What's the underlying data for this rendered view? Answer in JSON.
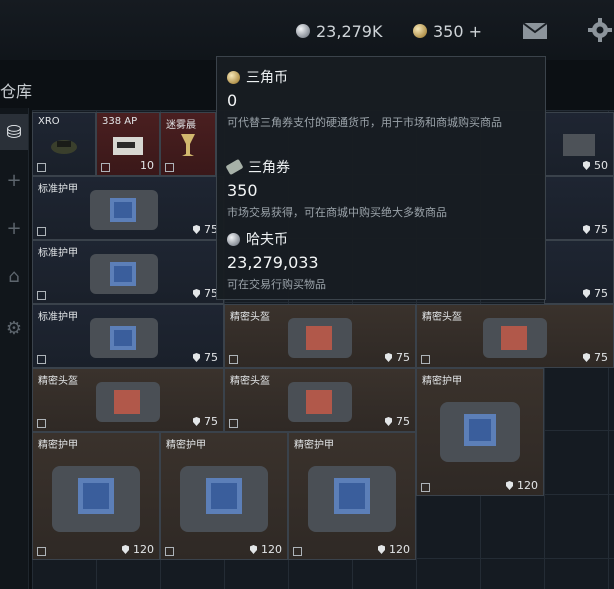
{
  "topbar": {
    "haf_coin": "23,279K",
    "triangle_coin": "350 +"
  },
  "sidebar": {
    "title": "仓库"
  },
  "items": [
    {
      "name": "XRO",
      "durability": ""
    },
    {
      "name": "338 AP",
      "durability": "10"
    },
    {
      "name": "迷雾晨",
      "durability": ""
    },
    {
      "name": "",
      "durability": "50"
    },
    {
      "name": "标准护甲",
      "durability": "75"
    },
    {
      "name": "",
      "durability": "75"
    },
    {
      "name": "标准护甲",
      "durability": "75"
    },
    {
      "name": "",
      "durability": "75"
    },
    {
      "name": "标准护甲",
      "durability": "75"
    },
    {
      "name": "精密头盔",
      "durability": "75"
    },
    {
      "name": "精密头盔",
      "durability": "75"
    },
    {
      "name": "精密头盔",
      "durability": "75"
    },
    {
      "name": "精密头盔",
      "durability": "75"
    },
    {
      "name": "精密护甲",
      "durability": "120"
    },
    {
      "name": "精密护甲",
      "durability": "120"
    },
    {
      "name": "精密护甲",
      "durability": "120"
    },
    {
      "name": "精密护甲",
      "durability": "120"
    }
  ],
  "tooltip": {
    "triangle_coin": {
      "name": "三角币",
      "value": "0",
      "desc": "可代替三角券支付的硬通货币，用于市场和商城购买商品"
    },
    "triangle_ticket": {
      "name": "三角券",
      "value": "350",
      "desc": "市场交易获得，可在商城中购买绝大多数商品"
    },
    "haf_coin": {
      "name": "哈夫币",
      "value": "23,279,033",
      "desc": "可在交易行购买物品"
    }
  },
  "colors": {
    "item_blue": "#1e2532",
    "item_brown": "#3a322c",
    "item_red": "#4a1f20",
    "tooltip_bg": "#181d22"
  }
}
